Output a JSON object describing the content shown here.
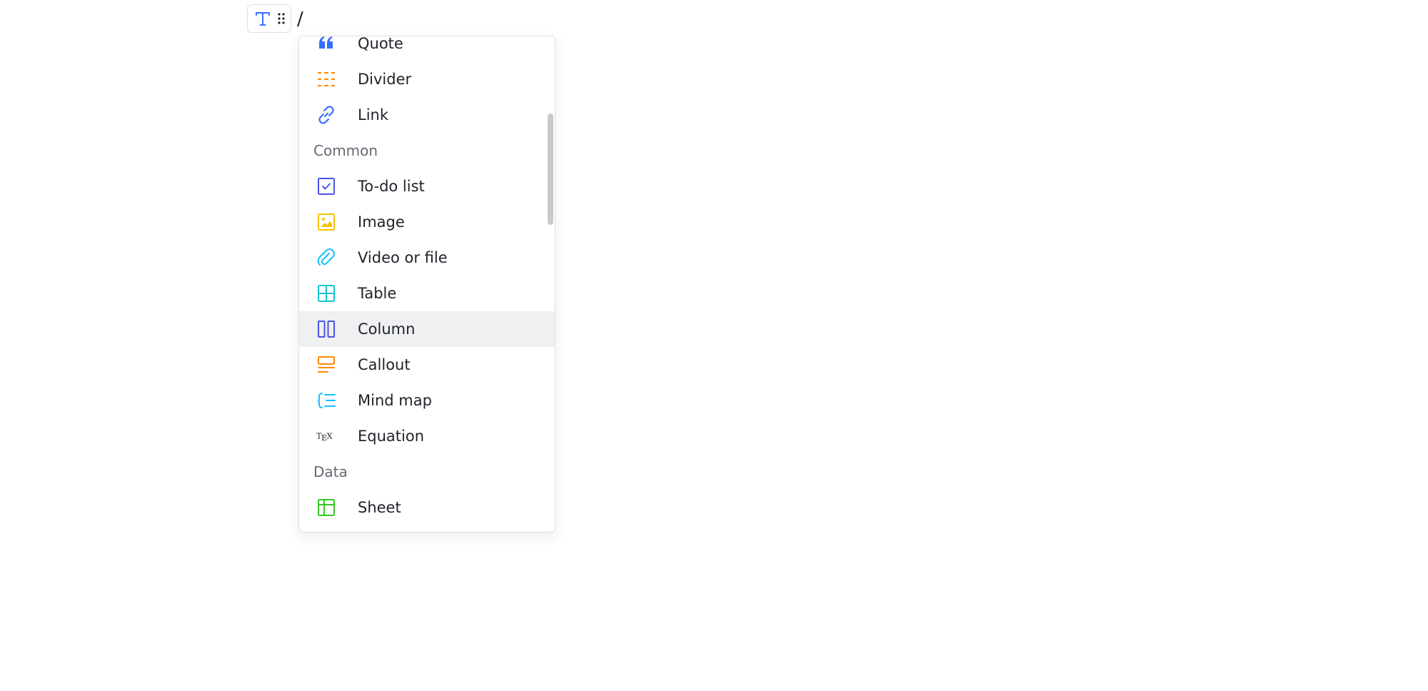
{
  "editor": {
    "slash_text": "/"
  },
  "menu": {
    "items_top": [
      {
        "label": "Quote",
        "icon": "quote-icon",
        "color": "#3370ff"
      },
      {
        "label": "Divider",
        "icon": "divider-icon",
        "color": "#ff8800"
      },
      {
        "label": "Link",
        "icon": "link-icon",
        "color": "#3370ff"
      }
    ],
    "section_common": "Common",
    "items_common": [
      {
        "label": "To-do list",
        "icon": "todo-checkbox-icon",
        "color": "#4954e6"
      },
      {
        "label": "Image",
        "icon": "image-icon",
        "color": "#f5c400"
      },
      {
        "label": "Video or file",
        "icon": "paperclip-icon",
        "color": "#14c0ff"
      },
      {
        "label": "Table",
        "icon": "table-icon",
        "color": "#14c9c9"
      },
      {
        "label": "Column",
        "icon": "column-icon",
        "color": "#4954e6",
        "highlighted": true
      },
      {
        "label": "Callout",
        "icon": "callout-icon",
        "color": "#ff8800"
      },
      {
        "label": "Mind map",
        "icon": "mind-map-icon",
        "color": "#14c0ff"
      },
      {
        "label": "Equation",
        "icon": "tex-icon",
        "color": "#1f2329",
        "icon_text": "TEX"
      }
    ],
    "section_data": "Data",
    "items_data": [
      {
        "label": "Sheet",
        "icon": "sheet-icon",
        "color": "#34c724"
      }
    ]
  }
}
